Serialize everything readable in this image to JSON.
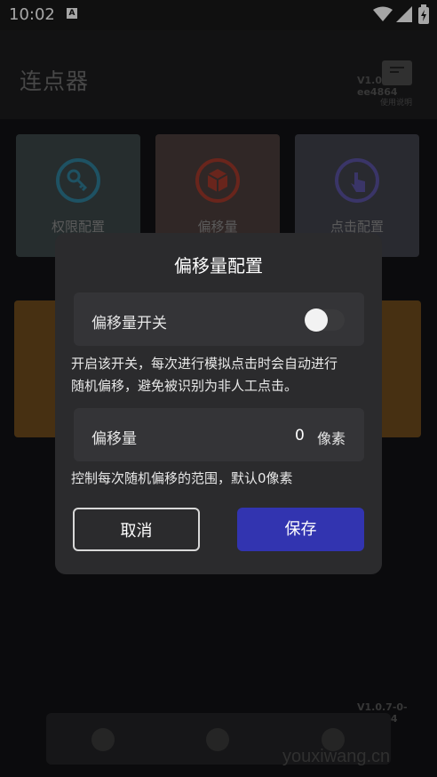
{
  "status_bar": {
    "time": "10:02",
    "notification_badge": "A"
  },
  "app": {
    "title": "连点器",
    "version": "V1.0.7-0-ee4864",
    "help_label": "使用说明"
  },
  "cards": [
    {
      "label": "权限配置",
      "icon": "key-icon",
      "color": "#3f9fc0"
    },
    {
      "label": "偏移量",
      "icon": "box-icon",
      "color": "#d04a3a"
    },
    {
      "label": "点击配置",
      "icon": "tap-icon",
      "color": "#7a6fd0"
    }
  ],
  "bottom_nav": {
    "items": [
      {
        "icon": "cursor-icon"
      },
      {
        "icon": "camera-icon"
      },
      {
        "icon": "user-icon"
      }
    ]
  },
  "watermark": "youxiwang.cn",
  "dialog": {
    "title": "偏移量配置",
    "switch_label": "偏移量开关",
    "switch_on": false,
    "switch_description_line1": "开启该开关，每次进行模拟点击时会自动进行",
    "switch_description_line2": "随机偏移，避免被识别为非人工点击。",
    "offset_label": "偏移量",
    "offset_value": "0",
    "offset_unit": "像素",
    "offset_description": "控制每次随机偏移的范围，默认0像素",
    "cancel_label": "取消",
    "save_label": "保存"
  },
  "colors": {
    "accent": "#3234b0",
    "dialog_bg": "#2b2b2d",
    "row_bg": "#343437"
  }
}
